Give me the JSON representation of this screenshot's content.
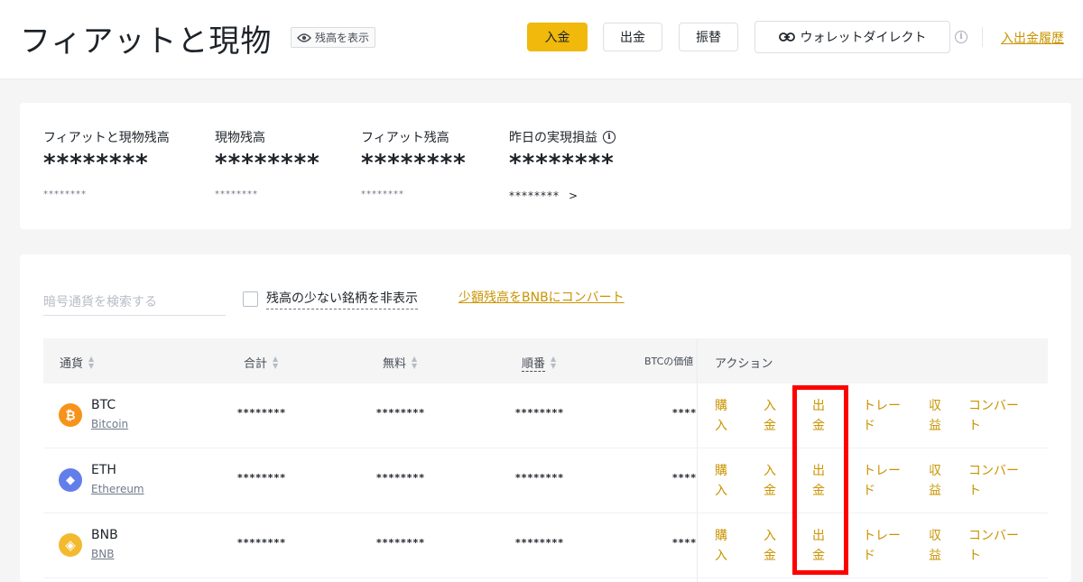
{
  "header": {
    "title": "フィアットと現物",
    "show_balance": "残高を表示",
    "deposit": "入金",
    "withdraw": "出金",
    "transfer": "振替",
    "wallet_direct": "ウォレットダイレクト",
    "history": "入出金履歴"
  },
  "balances": {
    "total_label": "フィアットと現物残高",
    "total_value": "********",
    "total_sub": "********",
    "spot_label": "現物残高",
    "spot_value": "********",
    "spot_sub": "********",
    "fiat_label": "フィアット残高",
    "fiat_value": "********",
    "fiat_sub": "********",
    "pnl_label": "昨日の実現損益",
    "pnl_value": "********",
    "pnl_sub": "********",
    "pnl_arrow": ">"
  },
  "filters": {
    "search_placeholder": "暗号通貨を検索する",
    "hide_small": "残高の少ない銘柄を非表示",
    "convert_small": "少額残高をBNBにコンバート"
  },
  "table": {
    "headers": {
      "coin": "通貨",
      "total": "合計",
      "available": "無料",
      "order": "順番",
      "btc_value": "BTCの価値",
      "action": "アクション"
    },
    "actions": {
      "buy": "購\n入",
      "deposit": "入\n金",
      "withdraw": "出\n金",
      "trade": "トレー\nド",
      "earn": "収\n益",
      "convert": "コンバー\nト"
    },
    "rows": [
      {
        "symbol": "BTC",
        "name": "Bitcoin",
        "total": "********",
        "available": "********",
        "order": "********",
        "btc_value": "********",
        "icon_color": "#f7931a",
        "icon": "₿"
      },
      {
        "symbol": "ETH",
        "name": "Ethereum",
        "total": "********",
        "available": "********",
        "order": "********",
        "btc_value": "********",
        "icon_color": "#627eea",
        "icon": "◆"
      },
      {
        "symbol": "BNB",
        "name": "BNB",
        "total": "********",
        "available": "********",
        "order": "********",
        "btc_value": "********",
        "icon_color": "#f3ba2f",
        "icon": "◈"
      }
    ]
  },
  "colors": {
    "brand": "#f0b90b",
    "link": "#c99400",
    "highlight": "#ff0000"
  }
}
